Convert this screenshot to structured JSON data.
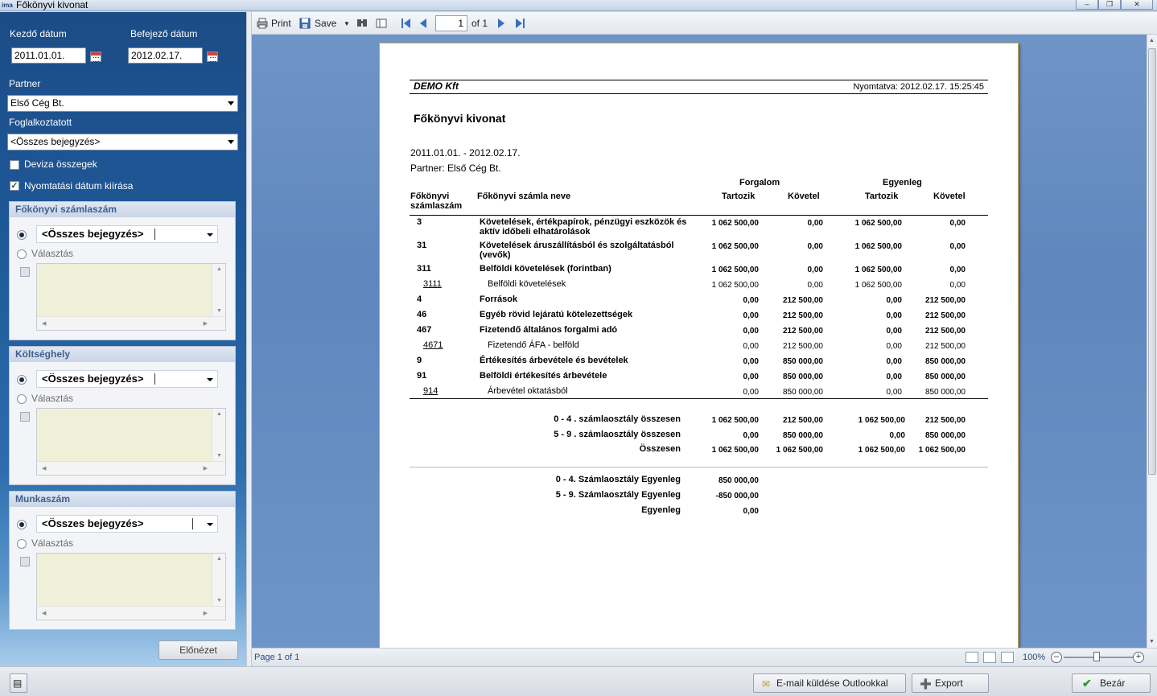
{
  "window": {
    "app_icon": "ima",
    "title": "Főkönyvi kivonat",
    "controls": [
      "minimize-icon",
      "restore-icon",
      "close-icon"
    ]
  },
  "left": {
    "start_date_label": "Kezdő dátum",
    "end_date_label": "Befejező dátum",
    "start_date": "2011.01.01.",
    "end_date": "2012.02.17.",
    "partner_label": "Partner",
    "partner_value": "Első Cég Bt.",
    "employee_label": "Foglalkoztatott",
    "employee_value": "<Összes bejegyzés>",
    "currency_label": "Deviza összegek",
    "currency_checked": false,
    "print_date_label": "Nyomtatási dátum kiírása",
    "print_date_checked": true,
    "groups": [
      {
        "title": "Főkönyvi számlaszám",
        "all_label": "<Összes bejegyzés>",
        "choose_label": "Választás"
      },
      {
        "title": "Költséghely",
        "all_label": "<Összes bejegyzés>",
        "choose_label": "Választás"
      },
      {
        "title": "Munkaszám",
        "all_label": "<Összes bejegyzés>",
        "choose_label": "Választás"
      }
    ],
    "preview_button": "Előnézet"
  },
  "toolbar": {
    "print_label": "Print",
    "save_label": "Save",
    "page_value": "1",
    "page_of": "of 1"
  },
  "report": {
    "company": "DEMO Kft",
    "printed": "Nyomtatva: 2012.02.17. 15:25:45",
    "title": "Főkönyvi kivonat",
    "period": "2011.01.01. - 2012.02.17.",
    "partner": "Partner: Első Cég Bt.",
    "col_account_no_1": "Főkönyvi",
    "col_account_no_2": "számlaszám",
    "col_account_name": "Főkönyvi számla neve",
    "col_turnover": "Forgalom",
    "col_balance": "Egyenleg",
    "col_debit": "Tartozik",
    "col_credit": "Követel",
    "rows": [
      {
        "no": "3",
        "name": "Követelések, értékpapírok, pénzügyi eszközök és",
        "name2": "aktív időbeli elhatárolások",
        "t_debit": "1 062 500,00",
        "t_credit": "0,00",
        "b_debit": "1 062 500,00",
        "b_credit": "0,00",
        "bold": true,
        "link": false
      },
      {
        "no": "31",
        "name": "Követelések áruszállításból és szolgáltatásból",
        "name2": "(vevők)",
        "t_debit": "1 062 500,00",
        "t_credit": "0,00",
        "b_debit": "1 062 500,00",
        "b_credit": "0,00",
        "bold": true,
        "link": false
      },
      {
        "no": "311",
        "name": "Belföldi követelések (forintban)",
        "name2": "",
        "t_debit": "1 062 500,00",
        "t_credit": "0,00",
        "b_debit": "1 062 500,00",
        "b_credit": "0,00",
        "bold": true,
        "link": false
      },
      {
        "no": "3111",
        "name": "Belföldi követelések",
        "name2": "",
        "t_debit": "1 062 500,00",
        "t_credit": "0,00",
        "b_debit": "1 062 500,00",
        "b_credit": "0,00",
        "bold": false,
        "link": true
      },
      {
        "no": "4",
        "name": "Források",
        "name2": "",
        "t_debit": "0,00",
        "t_credit": "212 500,00",
        "b_debit": "0,00",
        "b_credit": "212 500,00",
        "bold": true,
        "link": false
      },
      {
        "no": "46",
        "name": "Egyéb rövid lejáratú kötelezettségek",
        "name2": "",
        "t_debit": "0,00",
        "t_credit": "212 500,00",
        "b_debit": "0,00",
        "b_credit": "212 500,00",
        "bold": true,
        "link": false
      },
      {
        "no": "467",
        "name": "Fizetendő általános forgalmi adó",
        "name2": "",
        "t_debit": "0,00",
        "t_credit": "212 500,00",
        "b_debit": "0,00",
        "b_credit": "212 500,00",
        "bold": true,
        "link": false
      },
      {
        "no": "4671",
        "name": "Fizetendő ÁFA - belföld",
        "name2": "",
        "t_debit": "0,00",
        "t_credit": "212 500,00",
        "b_debit": "0,00",
        "b_credit": "212 500,00",
        "bold": false,
        "link": true
      },
      {
        "no": "9",
        "name": "Értékesítés árbevétele és bevételek",
        "name2": "",
        "t_debit": "0,00",
        "t_credit": "850 000,00",
        "b_debit": "0,00",
        "b_credit": "850 000,00",
        "bold": true,
        "link": false
      },
      {
        "no": "91",
        "name": "Belföldi értékesítés árbevétele",
        "name2": "",
        "t_debit": "0,00",
        "t_credit": "850 000,00",
        "b_debit": "0,00",
        "b_credit": "850 000,00",
        "bold": true,
        "link": false
      },
      {
        "no": "914",
        "name": "Árbevétel oktatásból",
        "name2": "",
        "t_debit": "0,00",
        "t_credit": "850 000,00",
        "b_debit": "0,00",
        "b_credit": "850 000,00",
        "bold": false,
        "link": true
      }
    ],
    "totals": [
      {
        "label": "0 - 4 . számlaosztály összesen",
        "t_debit": "1 062 500,00",
        "t_credit": "212 500,00",
        "b_debit": "1 062 500,00",
        "b_credit": "212 500,00"
      },
      {
        "label": "5 - 9 . számlaosztály összesen",
        "t_debit": "0,00",
        "t_credit": "850 000,00",
        "b_debit": "0,00",
        "b_credit": "850 000,00"
      },
      {
        "label": "Összesen",
        "t_debit": "1 062 500,00",
        "t_credit": "1 062 500,00",
        "b_debit": "1 062 500,00",
        "b_credit": "1 062 500,00"
      }
    ],
    "balances": [
      {
        "label": "0 - 4. Számlaosztály Egyenleg",
        "value": "850 000,00"
      },
      {
        "label": "5 - 9. Számlaosztály Egyenleg",
        "value": "-850 000,00"
      },
      {
        "label": "Egyenleg",
        "value": "0,00"
      }
    ]
  },
  "status": {
    "page_text": "Page 1 of 1",
    "zoom": "100%"
  },
  "bottom": {
    "email_button": "E-mail küldése Outlookkal",
    "export_button": "Export",
    "close_button": "Bezár"
  },
  "colors": {
    "panel_blue": "#1e5898",
    "viewer_blue": "#6f94c7",
    "link_blue": "#1a3ccf",
    "page_border": "#d4a93a"
  }
}
